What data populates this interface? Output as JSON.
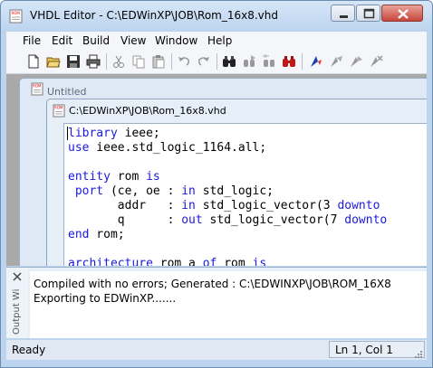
{
  "window": {
    "title": "VHDL Editor - C:\\EDWinXP\\JOB\\Rom_16x8.vhd"
  },
  "menu": [
    "File",
    "Edit",
    "Build",
    "View",
    "Window",
    "Help"
  ],
  "toolbar": {
    "icons": [
      "new-file-icon",
      "open-folder-icon",
      "save-icon",
      "print-icon",
      "cut-icon",
      "copy-icon",
      "paste-icon",
      "undo-icon",
      "redo-icon",
      "find-icon",
      "find-next-icon",
      "replace-icon",
      "find-in-files-icon",
      "toggle-bookmark-icon",
      "next-bookmark-icon",
      "prev-bookmark-icon",
      "clear-bookmarks-icon"
    ]
  },
  "mdi": {
    "back_title": "Untitled",
    "front_title": "C:\\EDWinXP\\JOB\\Rom_16x8.vhd",
    "doc_icon_text": "ROM"
  },
  "editor": {
    "lines": [
      [
        {
          "kw": true,
          "t": "library"
        },
        {
          "kw": false,
          "t": " ieee;"
        }
      ],
      [
        {
          "kw": true,
          "t": "use"
        },
        {
          "kw": false,
          "t": " ieee.std_logic_1164.all;"
        }
      ],
      [],
      [
        {
          "kw": true,
          "t": "entity"
        },
        {
          "kw": false,
          "t": " rom "
        },
        {
          "kw": true,
          "t": "is"
        }
      ],
      [
        {
          "kw": false,
          "t": " "
        },
        {
          "kw": true,
          "t": "port"
        },
        {
          "kw": false,
          "t": " (ce, oe : "
        },
        {
          "kw": true,
          "t": "in"
        },
        {
          "kw": false,
          "t": " std_logic;"
        }
      ],
      [
        {
          "kw": false,
          "t": "       addr   : "
        },
        {
          "kw": true,
          "t": "in"
        },
        {
          "kw": false,
          "t": " std_logic_vector(3 "
        },
        {
          "kw": true,
          "t": "downto"
        }
      ],
      [
        {
          "kw": false,
          "t": "       q      : "
        },
        {
          "kw": true,
          "t": "out"
        },
        {
          "kw": false,
          "t": " std_logic_vector(7 "
        },
        {
          "kw": true,
          "t": "downto"
        }
      ],
      [
        {
          "kw": true,
          "t": "end"
        },
        {
          "kw": false,
          "t": " rom;"
        }
      ],
      [],
      [
        {
          "kw": true,
          "t": "architecture"
        },
        {
          "kw": false,
          "t": " rom_a "
        },
        {
          "kw": true,
          "t": "of"
        },
        {
          "kw": false,
          "t": " rom "
        },
        {
          "kw": true,
          "t": "is"
        }
      ]
    ]
  },
  "output": {
    "label": "Output Wi",
    "lines": [
      "Compiled with no errors; Generated : C:\\EDWINXP\\JOB\\ROM_16X8",
      "Exporting to EDWinXP......."
    ]
  },
  "status": {
    "left": "Ready",
    "position": "Ln 1, Col 1"
  },
  "colors": {
    "keyword": "#1a1ae0",
    "titlebar": "#bcd4ee",
    "mdi_background": "#a9a9a9"
  }
}
